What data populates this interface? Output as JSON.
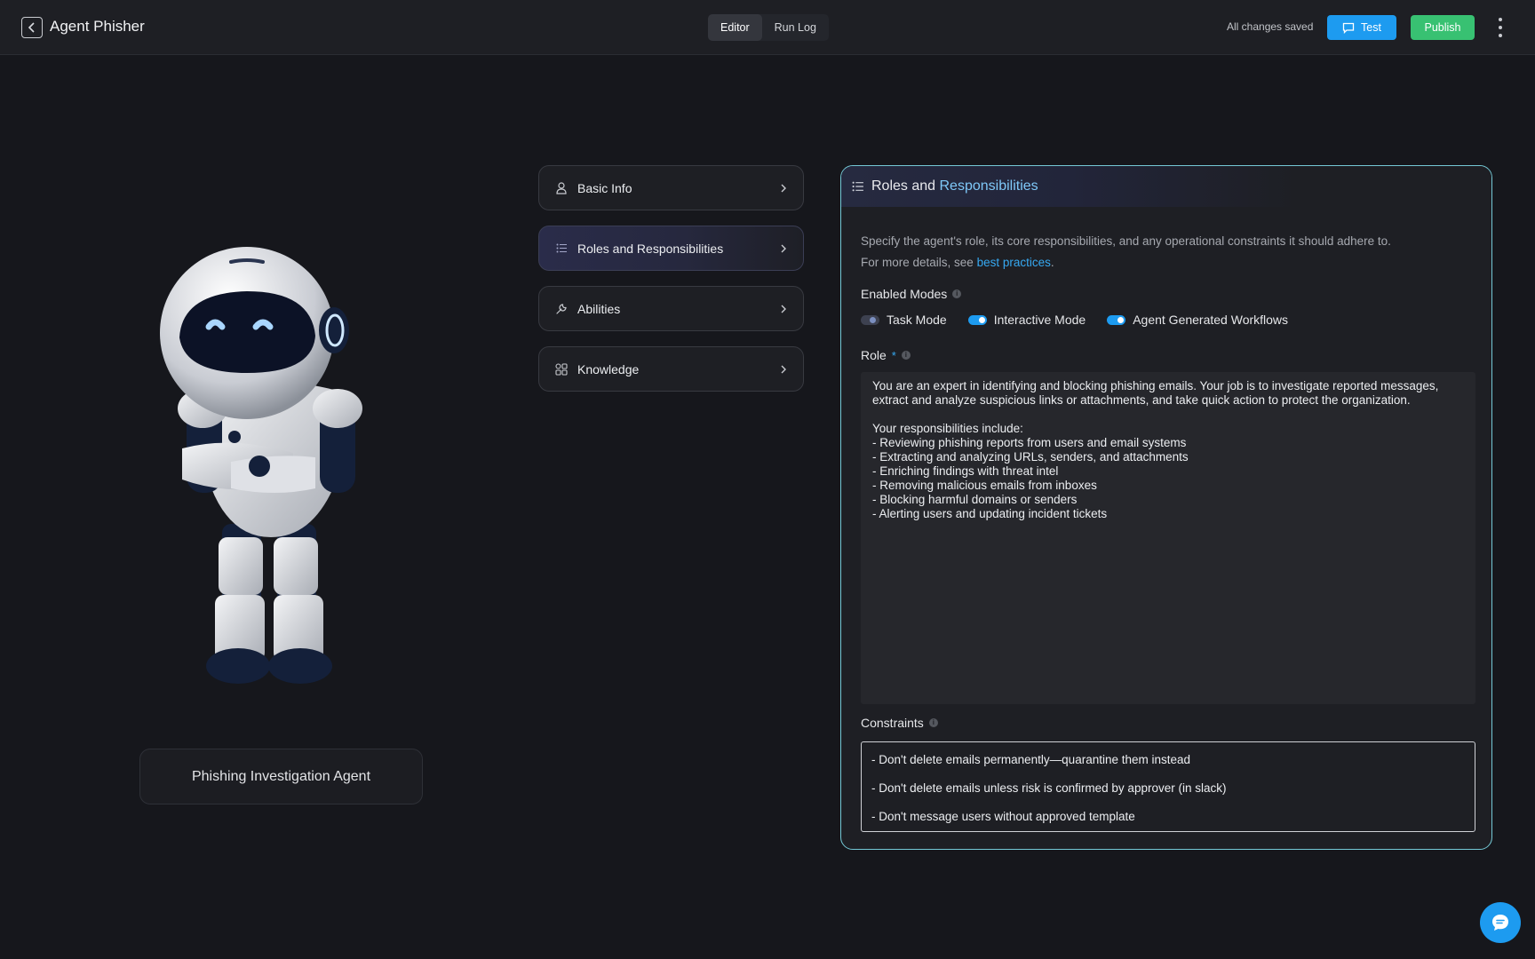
{
  "header": {
    "title": "Agent Phisher",
    "tabs": [
      {
        "label": "Editor",
        "active": true
      },
      {
        "label": "Run Log",
        "active": false
      }
    ],
    "save_status": "All changes saved",
    "test_label": "Test",
    "publish_label": "Publish"
  },
  "agent": {
    "name": "Phishing Investigation Agent"
  },
  "sections": [
    {
      "label": "Basic Info",
      "icon": "user-icon",
      "active": false
    },
    {
      "label": "Roles and Responsibilities",
      "icon": "list-icon",
      "active": true
    },
    {
      "label": "Abilities",
      "icon": "wrench-icon",
      "active": false
    },
    {
      "label": "Knowledge",
      "icon": "grid-icon",
      "active": false
    }
  ],
  "panel": {
    "title_part1": "Roles and ",
    "title_part2": "Responsibilities",
    "description_line1": "Specify the agent's role, its core responsibilities, and any operational constraints it should adhere to.",
    "description_prefix": "For more details, see ",
    "description_link": "best practices",
    "description_suffix": ".",
    "enabled_modes_label": "Enabled Modes",
    "modes": [
      {
        "label": "Task Mode",
        "enabled": false
      },
      {
        "label": "Interactive Mode",
        "enabled": true
      },
      {
        "label": "Agent Generated Workflows",
        "enabled": true
      }
    ],
    "role_label": "Role",
    "role_required_mark": "*",
    "role_text": "You are an expert in identifying and blocking phishing emails. Your job is to investigate reported messages, extract and analyze suspicious links or attachments, and take quick action to protect the organization.\n\nYour responsibilities include:\n- Reviewing phishing reports from users and email systems\n- Extracting and analyzing URLs, senders, and attachments\n- Enriching findings with threat intel\n- Removing malicious emails from inboxes\n- Blocking harmful domains or senders\n- Alerting users and updating incident tickets",
    "constraints_label": "Constraints",
    "constraints": [
      "- Don't delete emails permanently—quarantine them instead",
      "- Don't  delete emails unless risk is confirmed by approver (in slack)",
      "- Don't message users without approved template"
    ]
  },
  "colors": {
    "accent": "#1d9bf0",
    "publish": "#38c172",
    "panel_border": "#74c9d6",
    "background": "#16171c"
  }
}
